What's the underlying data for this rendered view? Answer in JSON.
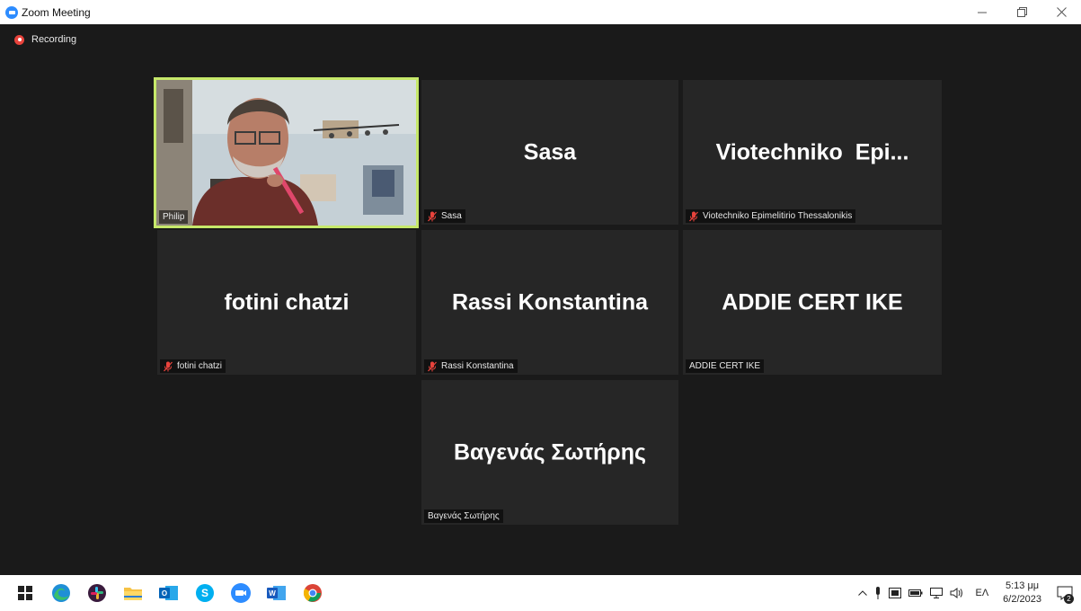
{
  "window": {
    "title": "Zoom Meeting"
  },
  "meeting": {
    "recording_label": "Recording",
    "participants": [
      {
        "display_name": "",
        "caption": "Philip",
        "muted": false,
        "video_on": true
      },
      {
        "display_name": "Sasa",
        "caption": "Sasa",
        "muted": true,
        "video_on": false
      },
      {
        "display_name": "Viotechniko  Epi...",
        "caption": "Viotechniko Epimelitirio Thessalonikis",
        "muted": true,
        "video_on": false
      },
      {
        "display_name": "fotini chatzi",
        "caption": "fotini chatzi",
        "muted": true,
        "video_on": false
      },
      {
        "display_name": "Rassi Konstantina",
        "caption": "Rassi Konstantina",
        "muted": true,
        "video_on": false
      },
      {
        "display_name": "ADDIE CERT IKE",
        "caption": "ADDIE CERT IKE",
        "muted": false,
        "video_on": false
      },
      {
        "display_name": "Βαγενάς Σωτήρης",
        "caption": "Βαγενάς Σωτήρης",
        "muted": false,
        "video_on": false
      }
    ],
    "active_speaker_color": "#c6e86a",
    "muted_icon_color": "#e8433c"
  },
  "taskbar": {
    "apps": [
      "windows-start",
      "edge",
      "slack",
      "file-explorer",
      "outlook",
      "skype",
      "zoom",
      "word",
      "chrome"
    ],
    "tray": {
      "language": "ΕΛ",
      "time": "5:13 μμ",
      "date": "6/2/2023",
      "notification_count": "2"
    }
  }
}
